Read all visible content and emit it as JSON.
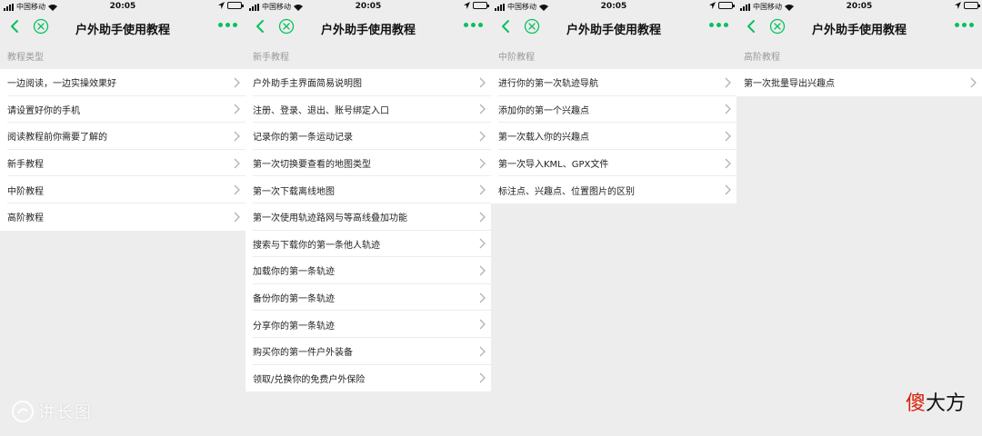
{
  "status_bar": {
    "carrier": "中国移动",
    "time": "20:05"
  },
  "nav": {
    "title": "户外助手使用教程"
  },
  "colors": {
    "accent": "#07c160",
    "background": "#ededed",
    "section_text": "#999999",
    "logo_red": "#d81e06"
  },
  "screens": [
    {
      "section": "教程类型",
      "items": [
        "一边阅读，一边实操效果好",
        "请设置好你的手机",
        "阅读教程前你需要了解的",
        "新手教程",
        "中阶教程",
        "高阶教程"
      ]
    },
    {
      "section": "新手教程",
      "items": [
        "户外助手主界面简易说明图",
        "注册、登录、退出、账号绑定入口",
        "记录你的第一条运动记录",
        "第一次切换要查看的地图类型",
        "第一次下载离线地图",
        "第一次使用轨迹路网与等高线叠加功能",
        "搜索与下载你的第一条他人轨迹",
        "加载你的第一条轨迹",
        "备份你的第一条轨迹",
        "分享你的第一条轨迹",
        "购买你的第一件户外装备",
        "领取/兑换你的免费户外保险"
      ]
    },
    {
      "section": "中阶教程",
      "items": [
        "进行你的第一次轨迹导航",
        "添加你的第一个兴趣点",
        "第一次载入你的兴趣点",
        "第一次导入KML、GPX文件",
        "标注点、兴趣点、位置图片的区别"
      ]
    },
    {
      "section": "高阶教程",
      "items": [
        "第一次批量导出兴趣点"
      ]
    }
  ],
  "watermark": {
    "text": "讲长图"
  },
  "logo": {
    "first_char": "傻",
    "rest": "大方"
  }
}
